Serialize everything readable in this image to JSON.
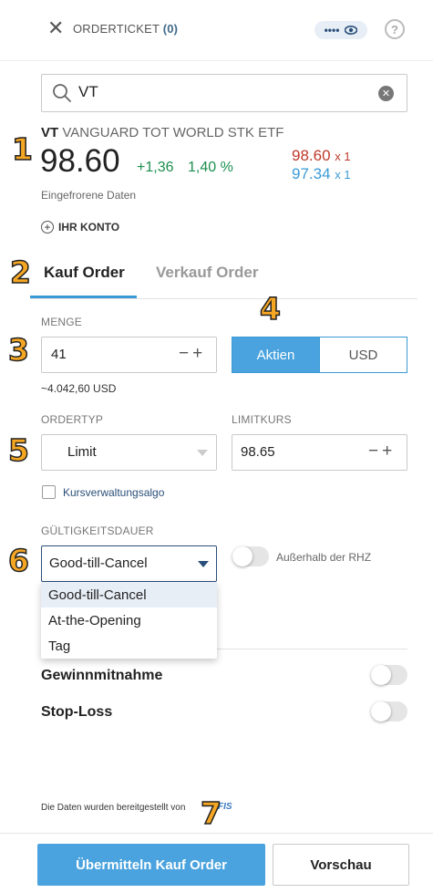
{
  "header": {
    "title": "ORDERTICKET",
    "count": "(0)",
    "privacy_dots": "••••",
    "privacy_icon": "eye-icon",
    "help_label": "?"
  },
  "search": {
    "value": "VT"
  },
  "quote": {
    "symbol": "VT",
    "name": "VANGUARD TOT WORLD STK ETF",
    "last": "98.60",
    "change_abs": "+1,36",
    "change_pct": "1,40 %",
    "ask": "98.60",
    "ask_size": "x 1",
    "bid": "97.34",
    "bid_size": "x 1",
    "note": "Eingefrorene Daten",
    "account_link": "IHR KONTO"
  },
  "tabs": {
    "buy": "Kauf Order",
    "sell": "Verkauf Order"
  },
  "quantity": {
    "label": "MENGE",
    "value": "41",
    "approx": "~4.042,60 USD",
    "unit_options": [
      "Aktien",
      "USD"
    ],
    "unit_selected": "Aktien"
  },
  "ordertype": {
    "label": "ORDERTYP",
    "value": "Limit"
  },
  "limit": {
    "label": "LIMITKURS",
    "value": "98.65"
  },
  "algo": {
    "label": "Kursverwaltungsalgo",
    "checked": false
  },
  "validity": {
    "label": "GÜLTIGKEITSDAUER",
    "value": "Good-till-Cancel",
    "options": [
      "Good-till-Cancel",
      "At-the-Opening",
      "Tag"
    ],
    "outside_rth_label": "Außerhalb der RHZ"
  },
  "profit_taker": {
    "label": "Gewinnmitnahme"
  },
  "stop_loss": {
    "label": "Stop-Loss"
  },
  "footer": {
    "provided_by": "Die Daten wurden bereitgestellt von",
    "provider": "FIS",
    "submit": "Übermitteln Kauf Order",
    "preview": "Vorschau"
  },
  "step_markers": [
    "1",
    "2",
    "3",
    "4",
    "5",
    "6",
    "7"
  ],
  "colors": {
    "accent": "#4aa3de",
    "positive": "#1b8f4e",
    "ask": "#c0392b",
    "bid": "#3b9ad6",
    "marker": "#f5a623"
  }
}
